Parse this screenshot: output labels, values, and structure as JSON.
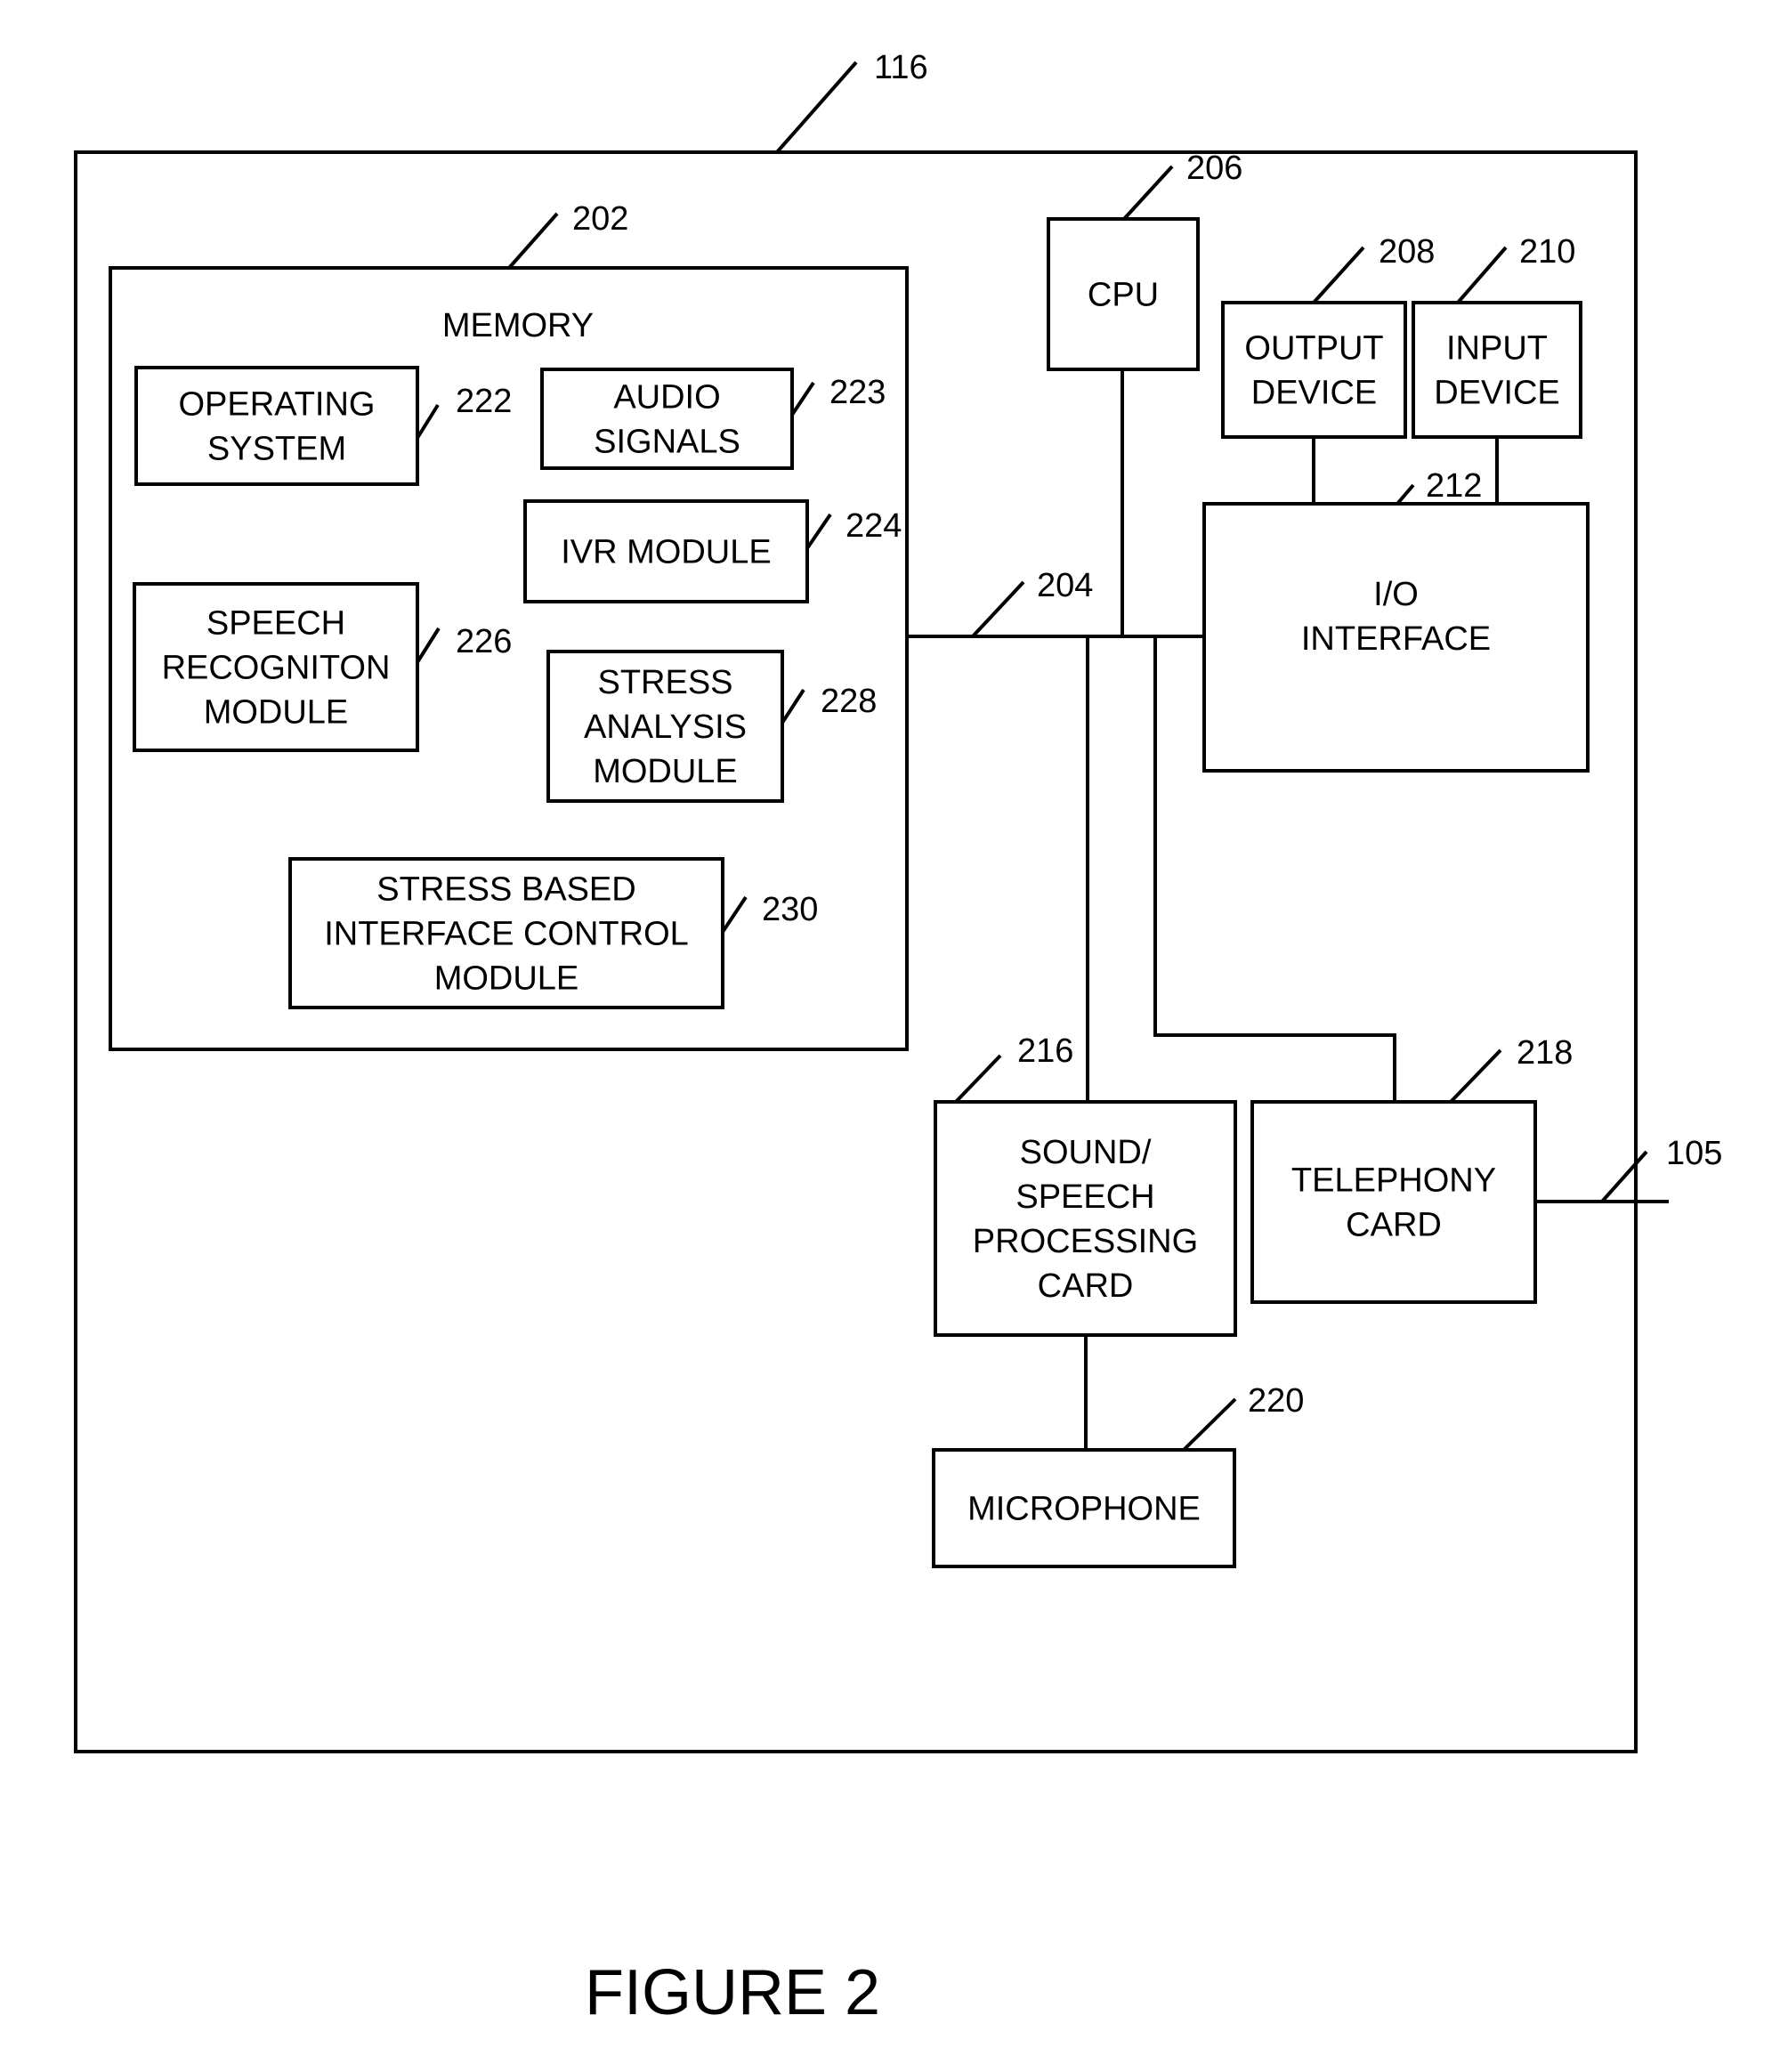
{
  "figure_caption": "FIGURE 2",
  "system": {
    "ref": "116"
  },
  "memory": {
    "label": "MEMORY",
    "ref": "202"
  },
  "bus": {
    "ref": "204"
  },
  "blocks": {
    "os": {
      "lines": [
        "OPERATING",
        "SYSTEM"
      ],
      "ref": "222"
    },
    "audio": {
      "lines": [
        "AUDIO",
        "SIGNALS"
      ],
      "ref": "223"
    },
    "ivr": {
      "lines": [
        "IVR MODULE"
      ],
      "ref": "224"
    },
    "speech_rec": {
      "lines": [
        "SPEECH",
        "RECOGNITON",
        "MODULE"
      ],
      "ref": "226"
    },
    "stress_analysis": {
      "lines": [
        "STRESS",
        "ANALYSIS",
        "MODULE"
      ],
      "ref": "228"
    },
    "stress_control": {
      "lines": [
        "STRESS BASED",
        "INTERFACE CONTROL",
        "MODULE"
      ],
      "ref": "230"
    },
    "cpu": {
      "lines": [
        "CPU"
      ],
      "ref": "206"
    },
    "output": {
      "lines": [
        "OUTPUT",
        "DEVICE"
      ],
      "ref": "208"
    },
    "input": {
      "lines": [
        "INPUT",
        "DEVICE"
      ],
      "ref": "210"
    },
    "io": {
      "lines": [
        "I/O",
        "INTERFACE"
      ],
      "ref": "212"
    },
    "sound": {
      "lines": [
        "SOUND/",
        "SPEECH",
        "PROCESSING",
        "CARD"
      ],
      "ref": "216"
    },
    "telephony": {
      "lines": [
        "TELEPHONY",
        "CARD"
      ],
      "ref": "218"
    },
    "microphone": {
      "lines": [
        "MICROPHONE"
      ],
      "ref": "220"
    }
  },
  "external_line": {
    "ref": "105"
  }
}
